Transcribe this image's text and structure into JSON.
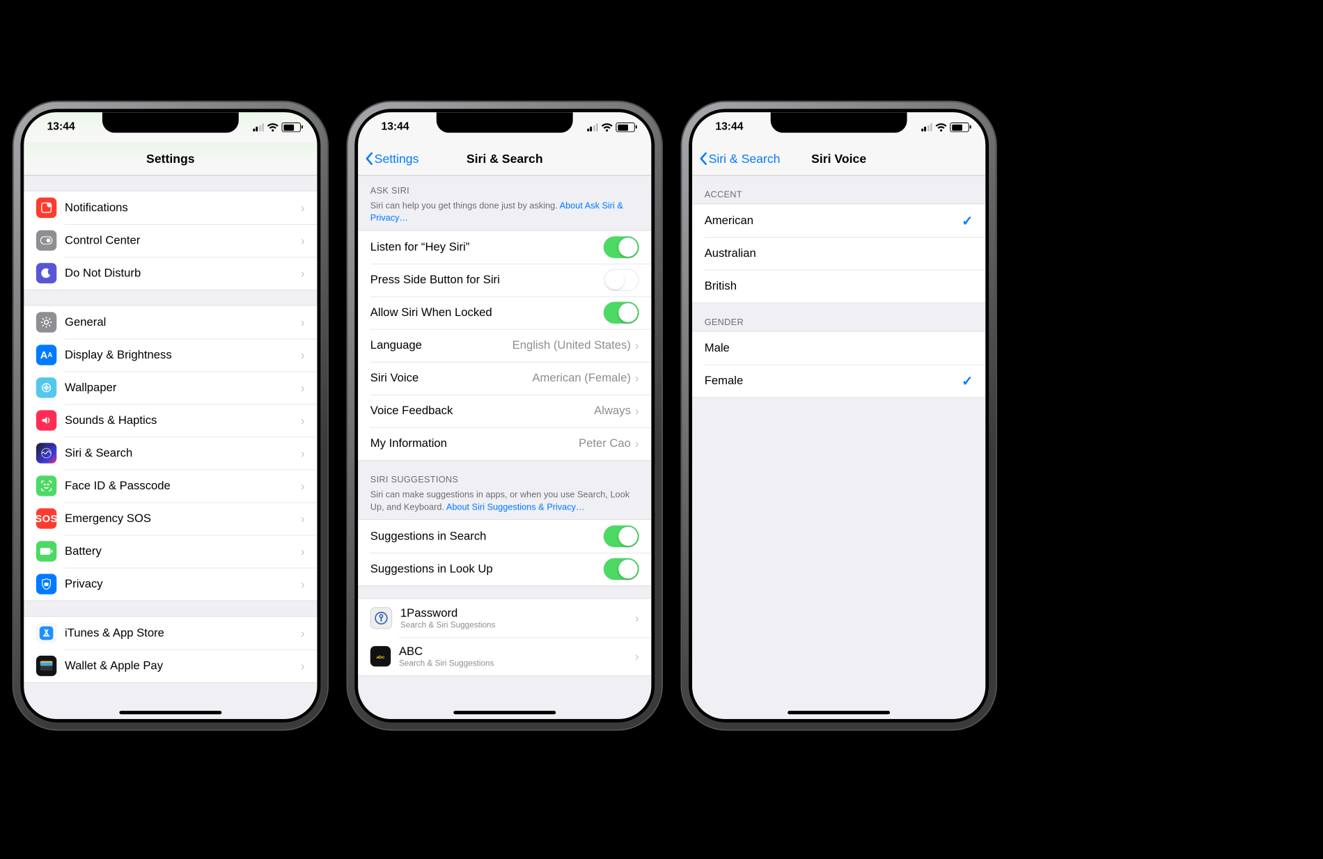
{
  "status": {
    "time": "13:44"
  },
  "screen1": {
    "title": "Settings",
    "group1": [
      {
        "key": "notifications",
        "label": "Notifications"
      },
      {
        "key": "control-center",
        "label": "Control Center"
      },
      {
        "key": "dnd",
        "label": "Do Not Disturb"
      }
    ],
    "group2": [
      {
        "key": "general",
        "label": "General"
      },
      {
        "key": "display",
        "label": "Display & Brightness"
      },
      {
        "key": "wallpaper",
        "label": "Wallpaper"
      },
      {
        "key": "sounds",
        "label": "Sounds & Haptics"
      },
      {
        "key": "siri",
        "label": "Siri & Search"
      },
      {
        "key": "faceid",
        "label": "Face ID & Passcode"
      },
      {
        "key": "sos",
        "label": "Emergency SOS"
      },
      {
        "key": "battery",
        "label": "Battery"
      },
      {
        "key": "privacy",
        "label": "Privacy"
      }
    ],
    "group3": [
      {
        "key": "itunes",
        "label": "iTunes & App Store"
      },
      {
        "key": "wallet",
        "label": "Wallet & Apple Pay"
      }
    ]
  },
  "screen2": {
    "back": "Settings",
    "title": "Siri & Search",
    "ask_header": "ASK SIRI",
    "ask_desc": "Siri can help you get things done just by asking. ",
    "ask_link": "About Ask Siri & Privacy…",
    "toggles": {
      "hey_siri": {
        "label": "Listen for “Hey Siri”",
        "on": true
      },
      "side_button": {
        "label": "Press Side Button for Siri",
        "on": false
      },
      "locked": {
        "label": "Allow Siri When Locked",
        "on": true
      }
    },
    "language": {
      "label": "Language",
      "value": "English (United States)"
    },
    "voice": {
      "label": "Siri Voice",
      "value": "American (Female)"
    },
    "feedback": {
      "label": "Voice Feedback",
      "value": "Always"
    },
    "myinfo": {
      "label": "My Information",
      "value": "Peter Cao"
    },
    "sugg_header": "SIRI SUGGESTIONS",
    "sugg_desc": "Siri can make suggestions in apps, or when you use Search, Look Up, and Keyboard. ",
    "sugg_link": "About Siri Suggestions & Privacy…",
    "sugg": {
      "search": {
        "label": "Suggestions in Search",
        "on": true
      },
      "lookup": {
        "label": "Suggestions in Look Up",
        "on": true
      }
    },
    "apps": [
      {
        "key": "1password",
        "label": "1Password",
        "sub": "Search & Siri Suggestions"
      },
      {
        "key": "abc",
        "label": "ABC",
        "sub": "Search & Siri Suggestions"
      }
    ]
  },
  "screen3": {
    "back": "Siri & Search",
    "title": "Siri Voice",
    "accent_header": "ACCENT",
    "accents": [
      {
        "label": "American",
        "selected": true
      },
      {
        "label": "Australian",
        "selected": false
      },
      {
        "label": "British",
        "selected": false
      }
    ],
    "gender_header": "GENDER",
    "genders": [
      {
        "label": "Male",
        "selected": false
      },
      {
        "label": "Female",
        "selected": true
      }
    ]
  }
}
